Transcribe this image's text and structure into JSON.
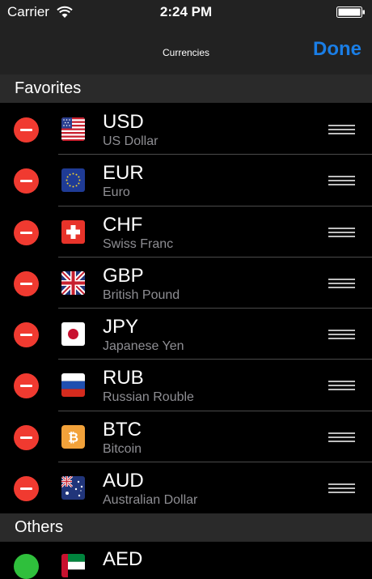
{
  "status_bar": {
    "carrier": "Carrier",
    "time": "2:24 PM"
  },
  "nav": {
    "title": "Currencies",
    "done_label": "Done"
  },
  "sections": {
    "favorites": "Favorites",
    "others": "Others"
  },
  "favorites": [
    {
      "code": "USD",
      "name": "US Dollar"
    },
    {
      "code": "EUR",
      "name": "Euro"
    },
    {
      "code": "CHF",
      "name": "Swiss Franc"
    },
    {
      "code": "GBP",
      "name": "British Pound"
    },
    {
      "code": "JPY",
      "name": "Japanese Yen"
    },
    {
      "code": "RUB",
      "name": "Russian Rouble"
    },
    {
      "code": "BTC",
      "name": "Bitcoin"
    },
    {
      "code": "AUD",
      "name": "Australian Dollar"
    }
  ],
  "others": [
    {
      "code": "AED"
    }
  ],
  "colors": {
    "accent": "#1a7ee6",
    "delete": "#f03a30",
    "add": "#2fbf3c",
    "background": "#000000",
    "bar": "#222222"
  }
}
